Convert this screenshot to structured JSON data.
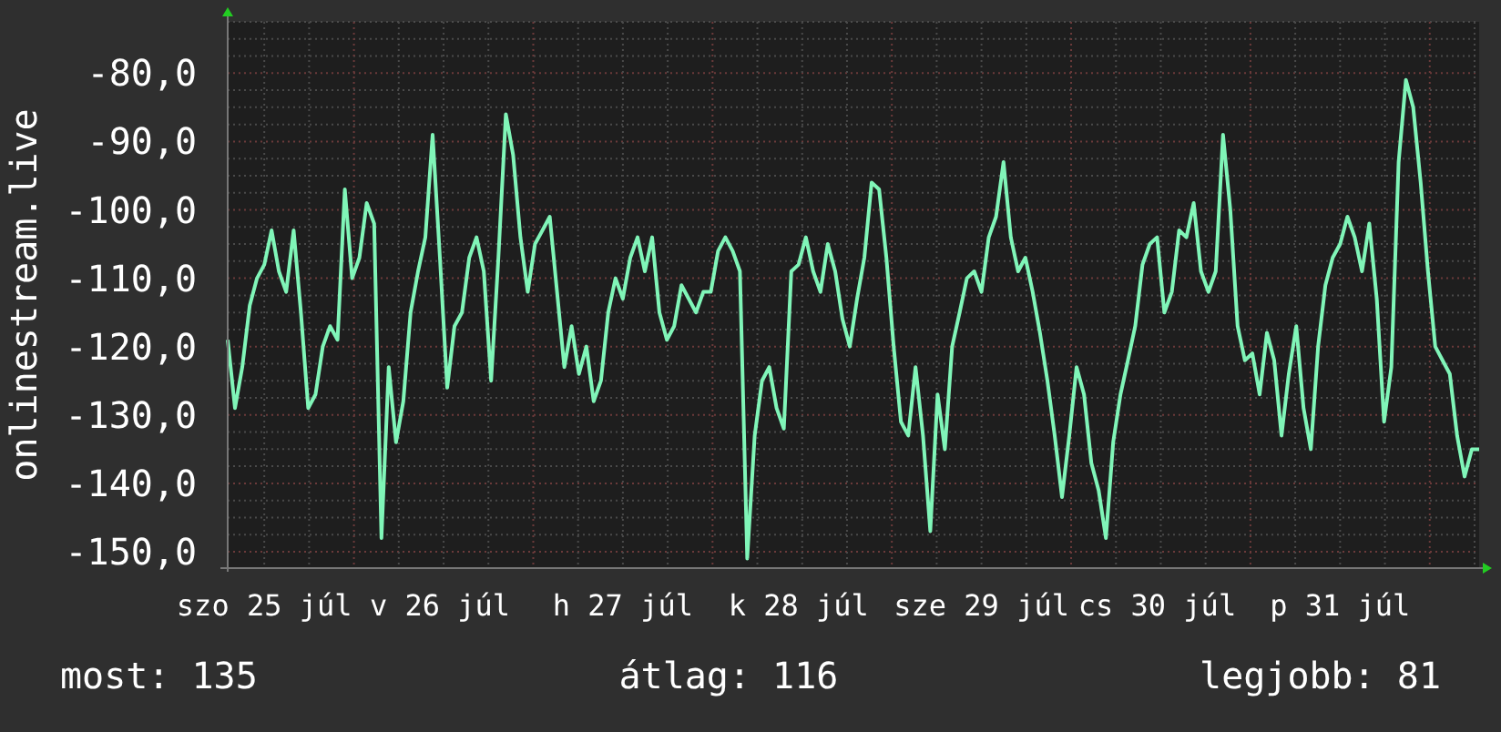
{
  "chart": {
    "chart_data": {
      "type": "line",
      "ylabel": "onlinestream.live",
      "grid": true,
      "ylim": [
        -152.4,
        -72.5
      ],
      "yticks": [
        {
          "value": -80,
          "label": "-80,0"
        },
        {
          "value": -90,
          "label": "-90,0"
        },
        {
          "value": -100,
          "label": "-100,0"
        },
        {
          "value": -110,
          "label": "-110,0"
        },
        {
          "value": -120,
          "label": "-120,0"
        },
        {
          "value": -130,
          "label": "-130,0"
        },
        {
          "value": -140,
          "label": "-140,0"
        },
        {
          "value": -150,
          "label": "-150,0"
        }
      ],
      "categories": [
        null,
        null,
        null,
        null,
        null,
        "szo 25 júl",
        null,
        null,
        null,
        null,
        null,
        null,
        null,
        null,
        null,
        null,
        null,
        null,
        null,
        null,
        null,
        null,
        null,
        null,
        null,
        null,
        null,
        null,
        null,
        "v 26 júl",
        null,
        null,
        null,
        null,
        null,
        null,
        null,
        null,
        null,
        null,
        null,
        null,
        null,
        null,
        null,
        null,
        null,
        null,
        null,
        null,
        null,
        null,
        null,
        null,
        "h 27 júl",
        null,
        null,
        null,
        null,
        null,
        null,
        null,
        null,
        null,
        null,
        null,
        null,
        null,
        null,
        null,
        null,
        null,
        null,
        null,
        null,
        null,
        null,
        null,
        "k 28 júl",
        null,
        null,
        null,
        null,
        null,
        null,
        null,
        null,
        null,
        null,
        null,
        null,
        null,
        null,
        null,
        null,
        null,
        null,
        null,
        null,
        null,
        null,
        null,
        null,
        "sze 29 júl",
        null,
        null,
        null,
        null,
        null,
        null,
        null,
        null,
        null,
        null,
        null,
        null,
        null,
        null,
        null,
        null,
        null,
        null,
        null,
        null,
        null,
        null,
        null,
        "cs 30 júl",
        null,
        null,
        null,
        null,
        null,
        null,
        null,
        null,
        null,
        null,
        null,
        null,
        null,
        null,
        null,
        null,
        null,
        null,
        null,
        null,
        null,
        null,
        null,
        null,
        "p 31 júl",
        null,
        null,
        null,
        null,
        null,
        null,
        null,
        null,
        null,
        null,
        null,
        null,
        null,
        null,
        null,
        null,
        null,
        null,
        null
      ],
      "series": [
        {
          "color": "#80f5b8",
          "values": [
            -119,
            -129,
            -123,
            -114,
            -110,
            -108,
            -103,
            -109,
            -112,
            -103,
            -115,
            -129,
            -127,
            -120,
            -117,
            -119,
            -97,
            -110,
            -107,
            -99,
            -102,
            -148,
            -123,
            -134,
            -128,
            -115,
            -109,
            -104,
            -89,
            -107,
            -126,
            -117,
            -115,
            -107,
            -104,
            -109,
            -125,
            -107,
            -86,
            -92,
            -104,
            -112,
            -105,
            -103,
            -101,
            -112,
            -123,
            -117,
            -124,
            -120,
            -128,
            -125,
            -115,
            -110,
            -113,
            -107,
            -104,
            -109,
            -104,
            -115,
            -119,
            -117,
            -111,
            -113,
            -115,
            -112,
            -112,
            -106,
            -104,
            -106,
            -109,
            -151,
            -133,
            -125,
            -123,
            -129,
            -132,
            -109,
            -108,
            -104,
            -109,
            -112,
            -105,
            -109,
            -116,
            -120,
            -113,
            -107,
            -96,
            -97,
            -107,
            -120,
            -131,
            -133,
            -123,
            -133,
            -147,
            -127,
            -135,
            -120,
            -115,
            -110,
            -109,
            -112,
            -104,
            -101,
            -93,
            -104,
            -109,
            -107,
            -112,
            -118,
            -125,
            -133,
            -142,
            -133,
            -123,
            -127,
            -137,
            -141,
            -148,
            -134,
            -127,
            -122,
            -117,
            -108,
            -105,
            -104,
            -115,
            -112,
            -103,
            -104,
            -99,
            -109,
            -112,
            -109,
            -89,
            -100,
            -117,
            -122,
            -121,
            -127,
            -118,
            -122,
            -133,
            -124,
            -117,
            -129,
            -135,
            -120,
            -111,
            -107,
            -105,
            -101,
            -104,
            -109,
            -102,
            -113,
            -131,
            -123,
            -93,
            -81,
            -85,
            -96,
            -109,
            -120,
            -122,
            -124,
            -133,
            -139,
            -135,
            -135
          ]
        }
      ]
    }
  },
  "stats": [
    "most: 135",
    "átlag: 116",
    "legjobb: 81"
  ]
}
